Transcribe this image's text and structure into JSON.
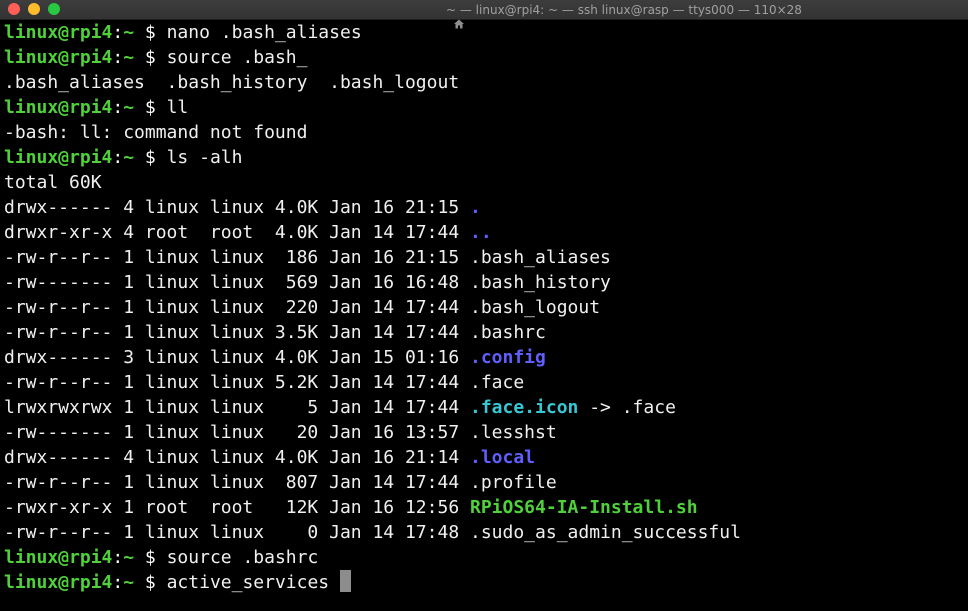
{
  "window": {
    "title": "~ — linux@rpi4: ~ — ssh linux@rasp — ttys000 — 110×28"
  },
  "prompt": {
    "user_host": "linux@rpi4",
    "path": "~",
    "symbol": "$"
  },
  "lines": [
    {
      "type": "cmd",
      "text": "nano .bash_aliases"
    },
    {
      "type": "cmd",
      "text": "source .bash_"
    },
    {
      "type": "out",
      "text": ".bash_aliases  .bash_history  .bash_logout"
    },
    {
      "type": "cmd",
      "text": "ll"
    },
    {
      "type": "out",
      "text": "-bash: ll: command not found"
    },
    {
      "type": "cmd",
      "text": "ls -alh"
    },
    {
      "type": "out",
      "text": "total 60K"
    }
  ],
  "listing": [
    {
      "meta": "drwx------ 4 linux linux 4.0K Jan 16 21:15 ",
      "name": ".",
      "kind": "dir"
    },
    {
      "meta": "drwxr-xr-x 4 root  root  4.0K Jan 14 17:44 ",
      "name": "..",
      "kind": "dir"
    },
    {
      "meta": "-rw-r--r-- 1 linux linux  186 Jan 16 21:15 ",
      "name": ".bash_aliases",
      "kind": "file"
    },
    {
      "meta": "-rw------- 1 linux linux  569 Jan 16 16:48 ",
      "name": ".bash_history",
      "kind": "file"
    },
    {
      "meta": "-rw-r--r-- 1 linux linux  220 Jan 14 17:44 ",
      "name": ".bash_logout",
      "kind": "file"
    },
    {
      "meta": "-rw-r--r-- 1 linux linux 3.5K Jan 14 17:44 ",
      "name": ".bashrc",
      "kind": "file"
    },
    {
      "meta": "drwx------ 3 linux linux 4.0K Jan 15 01:16 ",
      "name": ".config",
      "kind": "dir"
    },
    {
      "meta": "-rw-r--r-- 1 linux linux 5.2K Jan 14 17:44 ",
      "name": ".face",
      "kind": "file"
    },
    {
      "meta": "lrwxrwxrwx 1 linux linux    5 Jan 14 17:44 ",
      "name": ".face.icon",
      "kind": "link",
      "target": " -> .face"
    },
    {
      "meta": "-rw------- 1 linux linux   20 Jan 16 13:57 ",
      "name": ".lesshst",
      "kind": "file"
    },
    {
      "meta": "drwx------ 4 linux linux 4.0K Jan 16 21:14 ",
      "name": ".local",
      "kind": "dir"
    },
    {
      "meta": "-rw-r--r-- 1 linux linux  807 Jan 14 17:44 ",
      "name": ".profile",
      "kind": "file"
    },
    {
      "meta": "-rwxr-xr-x 1 root  root   12K Jan 16 12:56 ",
      "name": "RPiOS64-IA-Install.sh",
      "kind": "exec"
    },
    {
      "meta": "-rw-r--r-- 1 linux linux    0 Jan 14 17:48 ",
      "name": ".sudo_as_admin_successful",
      "kind": "file"
    }
  ],
  "tail": [
    {
      "type": "cmd",
      "text": "source .bashrc"
    },
    {
      "type": "cmd",
      "text": "active_services ",
      "cursor": true
    }
  ],
  "colors": {
    "prompt": "#4fd13a",
    "directory": "#5f5fff",
    "symlink": "#37c8d6",
    "executable": "#4fd13a",
    "text": "#f0f0f0",
    "background": "#000000"
  }
}
